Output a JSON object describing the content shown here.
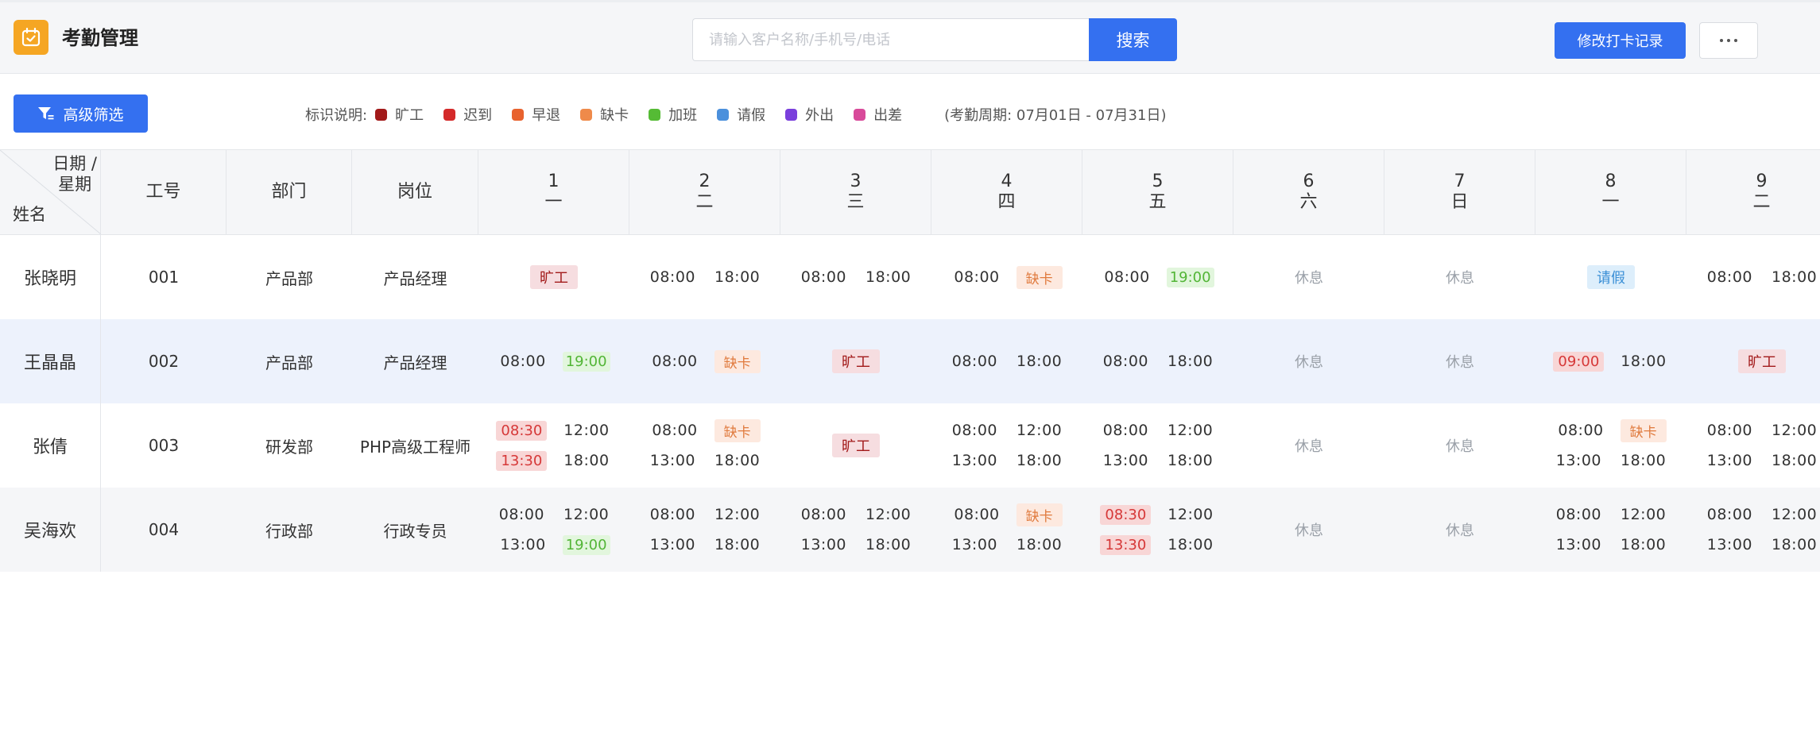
{
  "header": {
    "title": "考勤管理",
    "search_placeholder": "请输入客户名称/手机号/电话",
    "search_label": "搜索",
    "modify_label": "修改打卡记录"
  },
  "toolbar": {
    "filter_label": "高级筛选",
    "legend_title": "标识说明:",
    "legend": [
      {
        "label": "旷工",
        "color": "#a21a1a"
      },
      {
        "label": "迟到",
        "color": "#d42a2a"
      },
      {
        "label": "早退",
        "color": "#e8622e"
      },
      {
        "label": "缺卡",
        "color": "#ef8a4a"
      },
      {
        "label": "加班",
        "color": "#55bb35"
      },
      {
        "label": "请假",
        "color": "#4b90dc"
      },
      {
        "label": "外出",
        "color": "#7a3fdc"
      },
      {
        "label": "出差",
        "color": "#d84a9a"
      }
    ],
    "period": "(考勤周期: 07月01日 - 07月31日)"
  },
  "table": {
    "corner_top_line1": "日期 /",
    "corner_top_line2": "星期",
    "corner_bottom": "姓名",
    "headers": [
      "工号",
      "部门",
      "岗位"
    ],
    "days": [
      {
        "d": "1",
        "w": "一"
      },
      {
        "d": "2",
        "w": "二"
      },
      {
        "d": "3",
        "w": "三"
      },
      {
        "d": "4",
        "w": "四"
      },
      {
        "d": "5",
        "w": "五"
      },
      {
        "d": "6",
        "w": "六"
      },
      {
        "d": "7",
        "w": "日"
      },
      {
        "d": "8",
        "w": "一"
      },
      {
        "d": "9",
        "w": "二"
      }
    ],
    "rows": [
      {
        "name": "张晓明",
        "id": "001",
        "dept": "产品部",
        "post": "产品经理",
        "cells": [
          {
            "k": "tag",
            "text": "旷工",
            "type": "absent"
          },
          {
            "k": "times",
            "lines": [
              [
                {
                  "t": "08:00"
                },
                {
                  "t": "18:00"
                }
              ]
            ]
          },
          {
            "k": "times",
            "lines": [
              [
                {
                  "t": "08:00"
                },
                {
                  "t": "18:00"
                }
              ]
            ]
          },
          {
            "k": "times",
            "lines": [
              [
                {
                  "t": "08:00"
                },
                {
                  "t": "缺卡",
                  "s": "missing"
                }
              ]
            ]
          },
          {
            "k": "times",
            "lines": [
              [
                {
                  "t": "08:00"
                },
                {
                  "t": "19:00",
                  "s": "ot"
                }
              ]
            ]
          },
          {
            "k": "rest",
            "text": "休息"
          },
          {
            "k": "rest",
            "text": "休息"
          },
          {
            "k": "tag",
            "text": "请假",
            "type": "leave"
          },
          {
            "k": "times",
            "lines": [
              [
                {
                  "t": "08:00"
                },
                {
                  "t": "18:00"
                }
              ]
            ]
          }
        ]
      },
      {
        "name": "王晶晶",
        "id": "002",
        "dept": "产品部",
        "post": "产品经理",
        "cells": [
          {
            "k": "times",
            "lines": [
              [
                {
                  "t": "08:00"
                },
                {
                  "t": "19:00",
                  "s": "ot"
                }
              ]
            ]
          },
          {
            "k": "times",
            "lines": [
              [
                {
                  "t": "08:00"
                },
                {
                  "t": "缺卡",
                  "s": "missing"
                }
              ]
            ]
          },
          {
            "k": "tag",
            "text": "旷工",
            "type": "absent"
          },
          {
            "k": "times",
            "lines": [
              [
                {
                  "t": "08:00"
                },
                {
                  "t": "18:00"
                }
              ]
            ]
          },
          {
            "k": "times",
            "lines": [
              [
                {
                  "t": "08:00"
                },
                {
                  "t": "18:00"
                }
              ]
            ]
          },
          {
            "k": "rest",
            "text": "休息"
          },
          {
            "k": "rest",
            "text": "休息"
          },
          {
            "k": "times",
            "lines": [
              [
                {
                  "t": "09:00",
                  "s": "late"
                },
                {
                  "t": "18:00"
                }
              ]
            ]
          },
          {
            "k": "tag",
            "text": "旷工",
            "type": "absent"
          }
        ]
      },
      {
        "name": "张倩",
        "id": "003",
        "dept": "研发部",
        "post": "PHP高级工程师",
        "cells": [
          {
            "k": "times",
            "lines": [
              [
                {
                  "t": "08:30",
                  "s": "late"
                },
                {
                  "t": "12:00"
                }
              ],
              [
                {
                  "t": "13:30",
                  "s": "late"
                },
                {
                  "t": "18:00"
                }
              ]
            ]
          },
          {
            "k": "times",
            "lines": [
              [
                {
                  "t": "08:00"
                },
                {
                  "t": "缺卡",
                  "s": "missing"
                }
              ],
              [
                {
                  "t": "13:00"
                },
                {
                  "t": "18:00"
                }
              ]
            ]
          },
          {
            "k": "tag",
            "text": "旷工",
            "type": "absent"
          },
          {
            "k": "times",
            "lines": [
              [
                {
                  "t": "08:00"
                },
                {
                  "t": "12:00"
                }
              ],
              [
                {
                  "t": "13:00"
                },
                {
                  "t": "18:00"
                }
              ]
            ]
          },
          {
            "k": "times",
            "lines": [
              [
                {
                  "t": "08:00"
                },
                {
                  "t": "12:00"
                }
              ],
              [
                {
                  "t": "13:00"
                },
                {
                  "t": "18:00"
                }
              ]
            ]
          },
          {
            "k": "rest",
            "text": "休息"
          },
          {
            "k": "rest",
            "text": "休息"
          },
          {
            "k": "times",
            "lines": [
              [
                {
                  "t": "08:00"
                },
                {
                  "t": "缺卡",
                  "s": "missing"
                }
              ],
              [
                {
                  "t": "13:00"
                },
                {
                  "t": "18:00"
                }
              ]
            ]
          },
          {
            "k": "times",
            "lines": [
              [
                {
                  "t": "08:00"
                },
                {
                  "t": "12:00"
                }
              ],
              [
                {
                  "t": "13:00"
                },
                {
                  "t": "18:00"
                }
              ]
            ]
          }
        ]
      },
      {
        "name": "吴海欢",
        "id": "004",
        "dept": "行政部",
        "post": "行政专员",
        "cells": [
          {
            "k": "times",
            "lines": [
              [
                {
                  "t": "08:00"
                },
                {
                  "t": "12:00"
                }
              ],
              [
                {
                  "t": "13:00"
                },
                {
                  "t": "19:00",
                  "s": "ot"
                }
              ]
            ]
          },
          {
            "k": "times",
            "lines": [
              [
                {
                  "t": "08:00"
                },
                {
                  "t": "12:00"
                }
              ],
              [
                {
                  "t": "13:00"
                },
                {
                  "t": "18:00"
                }
              ]
            ]
          },
          {
            "k": "times",
            "lines": [
              [
                {
                  "t": "08:00"
                },
                {
                  "t": "12:00"
                }
              ],
              [
                {
                  "t": "13:00"
                },
                {
                  "t": "18:00"
                }
              ]
            ]
          },
          {
            "k": "times",
            "lines": [
              [
                {
                  "t": "08:00"
                },
                {
                  "t": "缺卡",
                  "s": "missing"
                }
              ],
              [
                {
                  "t": "13:00"
                },
                {
                  "t": "18:00"
                }
              ]
            ]
          },
          {
            "k": "times",
            "lines": [
              [
                {
                  "t": "08:30",
                  "s": "late"
                },
                {
                  "t": "12:00"
                }
              ],
              [
                {
                  "t": "13:30",
                  "s": "late"
                },
                {
                  "t": "18:00"
                }
              ]
            ]
          },
          {
            "k": "rest",
            "text": "休息"
          },
          {
            "k": "rest",
            "text": "休息"
          },
          {
            "k": "times",
            "lines": [
              [
                {
                  "t": "08:00"
                },
                {
                  "t": "12:00"
                }
              ],
              [
                {
                  "t": "13:00"
                },
                {
                  "t": "18:00"
                }
              ]
            ]
          },
          {
            "k": "times",
            "lines": [
              [
                {
                  "t": "08:00"
                },
                {
                  "t": "12:00"
                }
              ],
              [
                {
                  "t": "13:00"
                },
                {
                  "t": "18:00"
                }
              ]
            ]
          }
        ]
      }
    ]
  }
}
